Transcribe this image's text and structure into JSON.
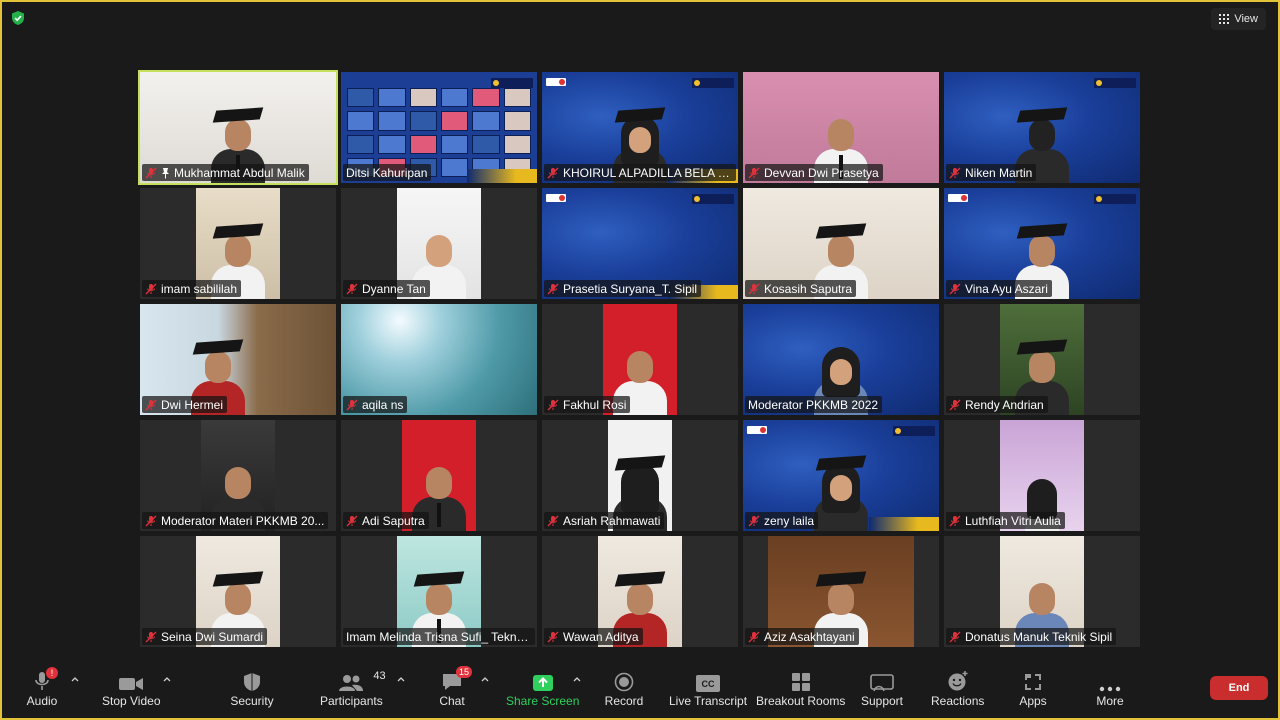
{
  "top_bar": {
    "view_label": "View"
  },
  "participants_grid": [
    {
      "name": "Mukhammat Abdul Malik",
      "pinned": true,
      "active": true
    },
    {
      "name": "Ditsi Kahuripan"
    },
    {
      "name": "KHOIRUL ALPADILLA BELA WA..."
    },
    {
      "name": "Devvan Dwi Prasetya"
    },
    {
      "name": "Niken Martin"
    },
    {
      "name": "imam sabililah"
    },
    {
      "name": "Dyanne Tan"
    },
    {
      "name": "Prasetia Suryana_T. Sipil"
    },
    {
      "name": "Kosasih Saputra"
    },
    {
      "name": "Vina Ayu Aszari"
    },
    {
      "name": "Dwi Hermei"
    },
    {
      "name": "aqila ns"
    },
    {
      "name": "Fakhul Rosi"
    },
    {
      "name": "Moderator PKKMB 2022"
    },
    {
      "name": "Rendy Andrian"
    },
    {
      "name": "Moderator Materi PKKMB 20..."
    },
    {
      "name": "Adi Saputra"
    },
    {
      "name": "Asriah Rahmawati"
    },
    {
      "name": "zeny laila"
    },
    {
      "name": "Luthfiah Vitri Aulia"
    },
    {
      "name": "Seina Dwi Sumardi"
    },
    {
      "name": "Imam Melinda Trisna Sufi_ Teknik..."
    },
    {
      "name": "Wawan Aditya"
    },
    {
      "name": "Aziz Asakhtayani"
    },
    {
      "name": "Donatus Manuk Teknik Sipil"
    }
  ],
  "toolbar": {
    "audio": {
      "label": "Audio",
      "badge": "!"
    },
    "video": {
      "label": "Stop Video"
    },
    "security": {
      "label": "Security"
    },
    "participants": {
      "label": "Participants",
      "count": "43"
    },
    "chat": {
      "label": "Chat",
      "badge": "15"
    },
    "share": {
      "label": "Share Screen"
    },
    "record": {
      "label": "Record"
    },
    "transcript": {
      "label": "Live Transcript",
      "icon_text": "CC"
    },
    "breakout": {
      "label": "Breakout Rooms"
    },
    "support": {
      "label": "Support"
    },
    "reactions": {
      "label": "Reactions"
    },
    "apps": {
      "label": "Apps"
    },
    "more": {
      "label": "More"
    },
    "end": {
      "label": "End"
    }
  },
  "colors": {
    "active_speaker_border": "#c5e05a",
    "share_green": "#2fd05d",
    "end_red": "#c92d2d",
    "mute_red": "#e0323c",
    "window_border": "#e3c33a"
  }
}
